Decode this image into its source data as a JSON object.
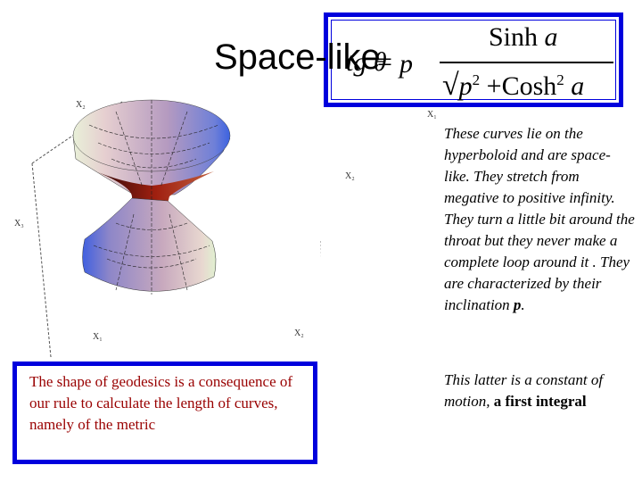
{
  "slide": {
    "title": "Space-like",
    "equation": {
      "lhs": "tg θ",
      "equals": "=",
      "coefficient": "p",
      "numerator_func": "Sinh",
      "numerator_var": "a",
      "denominator_var_p": "p",
      "denominator_exp": "2",
      "denominator_plus": "+",
      "denominator_func": "Cosh",
      "denominator_func_exp": "2",
      "denominator_var": "a"
    },
    "plot": {
      "axis_labels": {
        "x2_top": "X₂",
        "x3_left": "X₃",
        "x1_bottom": "X₁",
        "x2_bottom": "X₂",
        "x1_right": "X₁",
        "x2_right": "X₂"
      }
    },
    "description": "These curves lie on the hyperboloid and are space-like. They stretch from megative to positive infinity. They turn a little bit around the throat but they never make a complete loop around it . They are characterized by their inclination",
    "description_bold": "p",
    "description_end": ".",
    "note_italic": "This latter is a constant of motion,",
    "note_bold": "a first integral",
    "box_text": "The shape of geodesics is a consequence of our rule to calculate the length of curves, namely of the metric",
    "colors": {
      "box_border": "#0000dd",
      "box_text": "#990000"
    }
  }
}
